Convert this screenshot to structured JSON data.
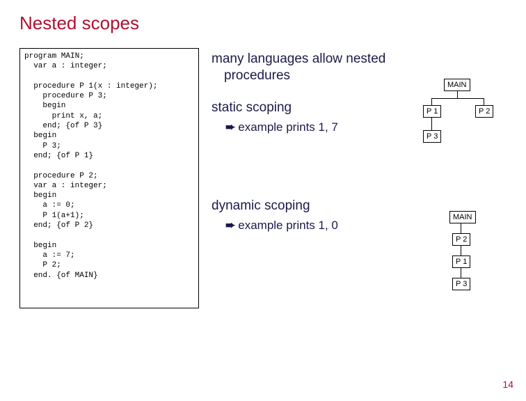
{
  "title": "Nested scopes",
  "code": "program MAIN;\n  var a : integer;\n\n  procedure P 1(x : integer);\n    procedure P 3;\n    begin\n      print x, a;\n    end; {of P 3}\n  begin\n    P 3;\n  end; {of P 1}\n\n  procedure P 2;\n  var a : integer;\n  begin\n    a := 0;\n    P 1(a+1);\n  end; {of P 2}\n\n  begin\n    a := 7;\n    P 2;\n  end. {of MAIN}",
  "text": {
    "para1_l1": "many languages allow nested",
    "para1_l2": "procedures",
    "para2": "static scoping",
    "sub2": "example prints 1, 7",
    "para3": "dynamic scoping",
    "sub3": "example prints 1, 0"
  },
  "diagrams": {
    "d1": {
      "root": "MAIN",
      "c1": "P 1",
      "c2": "P 2",
      "gc": "P 3"
    },
    "d2": {
      "n1": "MAIN",
      "n2": "P 2",
      "n3": "P 1",
      "n4": "P 3"
    }
  },
  "page": "14"
}
